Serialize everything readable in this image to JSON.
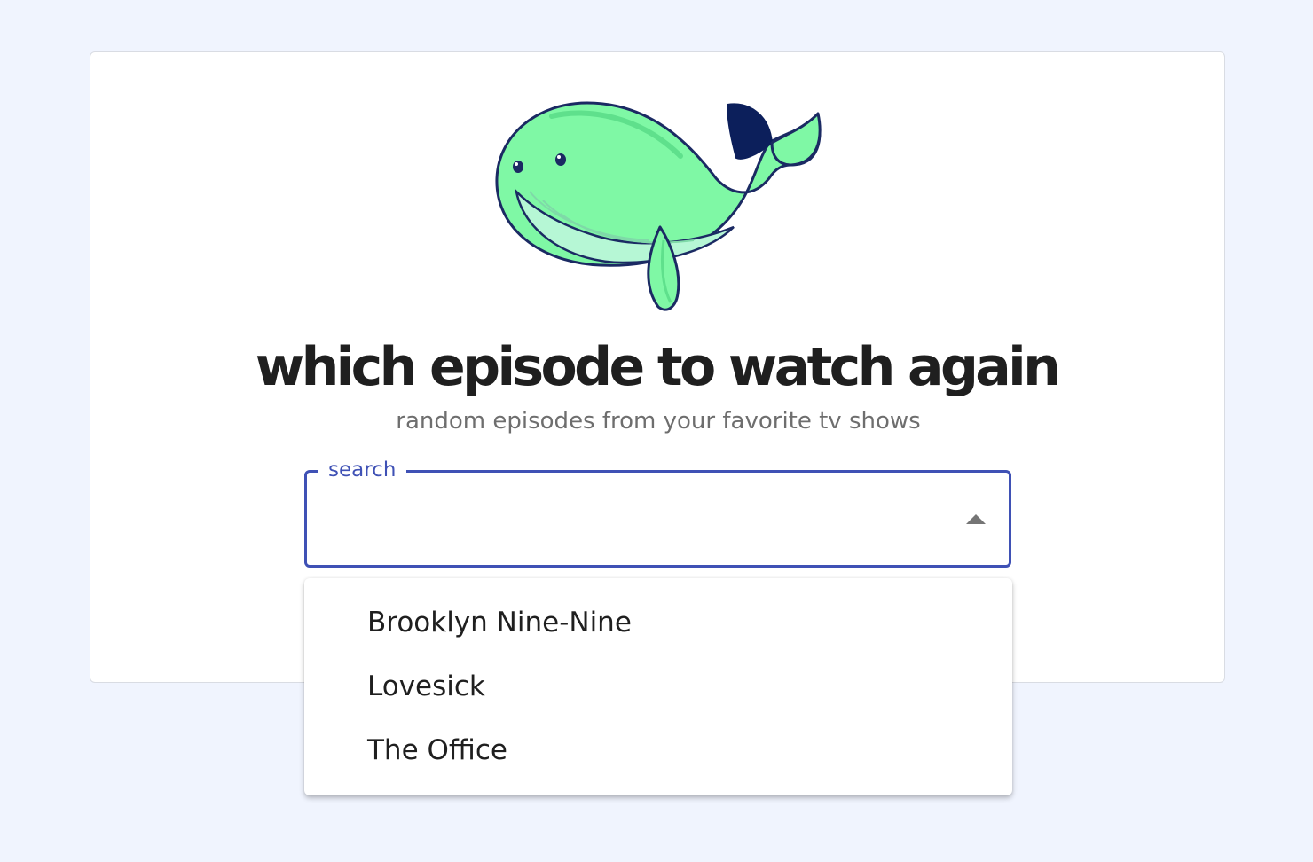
{
  "header": {
    "logo_icon": "whale-icon",
    "title": "which episode to watch again",
    "subtitle": "random episodes from your favorite tv shows"
  },
  "search": {
    "label": "search",
    "value": "",
    "toggle_icon": "caret-up-icon",
    "expanded": true,
    "options": [
      {
        "label": "Brooklyn Nine-Nine"
      },
      {
        "label": "Lovesick"
      },
      {
        "label": "The Office"
      }
    ]
  },
  "colors": {
    "background": "#f0f4fe",
    "card": "#ffffff",
    "accent": "#3f51b5",
    "whale_body": "#7ff8a5",
    "whale_belly": "#b6f7d5",
    "whale_outline": "#1b2a63",
    "whale_tail": "#0c1f5b"
  }
}
